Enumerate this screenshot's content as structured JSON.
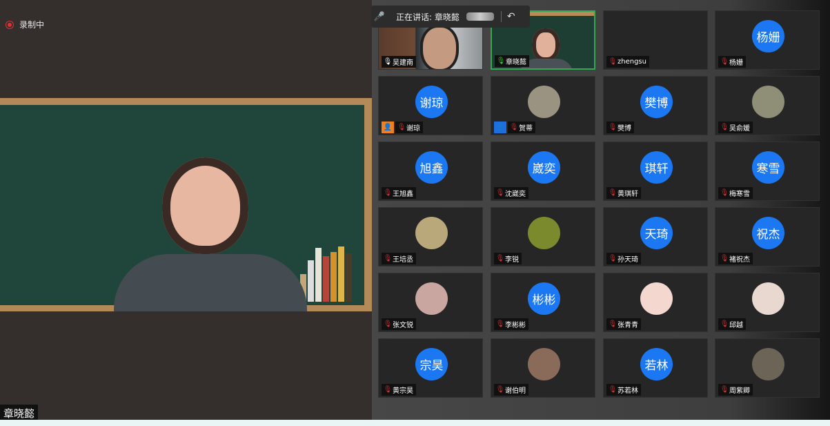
{
  "recording": {
    "label": "录制中",
    "icon": "record-icon"
  },
  "main_video": {
    "speaker_name": "章晓懿"
  },
  "speaking_bar": {
    "text": "正在讲话: 章晓懿",
    "mic_icon": "mic-muted-icon",
    "return_icon": "return-icon"
  },
  "participants": [
    {
      "name": "吴建南",
      "type": "video",
      "mic": "on",
      "row": 0,
      "col": 0
    },
    {
      "name": "章晓懿",
      "type": "video",
      "mic": "green",
      "row": 0,
      "col": 1,
      "active": true
    },
    {
      "name": "zhengsu",
      "type": "blank",
      "mic": "muted",
      "row": 0,
      "col": 2
    },
    {
      "name": "杨姗",
      "type": "avatar",
      "avatar_text": "杨姗",
      "mic": "muted",
      "row": 0,
      "col": 3
    },
    {
      "name": "谢琼",
      "type": "avatar",
      "avatar_text": "谢琼",
      "mic": "muted",
      "row": 1,
      "col": 0,
      "badge": "orange"
    },
    {
      "name": "贺蒂",
      "type": "photo",
      "photo_color": "#9a9382",
      "mic": "muted",
      "row": 1,
      "col": 1,
      "badge": "blue"
    },
    {
      "name": "樊博",
      "type": "avatar",
      "avatar_text": "樊博",
      "mic": "muted",
      "row": 1,
      "col": 2
    },
    {
      "name": "吴俞媛",
      "type": "photo",
      "photo_color": "#8f8f78",
      "mic": "muted",
      "row": 1,
      "col": 3
    },
    {
      "name": "王旭鑫",
      "type": "avatar",
      "avatar_text": "旭鑫",
      "mic": "muted",
      "row": 2,
      "col": 0
    },
    {
      "name": "沈崴奕",
      "type": "avatar",
      "avatar_text": "崴奕",
      "mic": "muted",
      "row": 2,
      "col": 1
    },
    {
      "name": "黄琪轩",
      "type": "avatar",
      "avatar_text": "琪轩",
      "mic": "muted",
      "row": 2,
      "col": 2
    },
    {
      "name": "梅寒雪",
      "type": "avatar",
      "avatar_text": "寒雪",
      "mic": "muted",
      "row": 2,
      "col": 3
    },
    {
      "name": "王培丞",
      "type": "photo",
      "photo_color": "#b9a87a",
      "mic": "muted",
      "row": 3,
      "col": 0
    },
    {
      "name": "李锐",
      "type": "photo",
      "photo_color": "#7b8a2c",
      "mic": "muted",
      "row": 3,
      "col": 1
    },
    {
      "name": "孙天琦",
      "type": "avatar",
      "avatar_text": "天琦",
      "mic": "muted",
      "row": 3,
      "col": 2
    },
    {
      "name": "褚祝杰",
      "type": "avatar",
      "avatar_text": "祝杰",
      "mic": "muted",
      "row": 3,
      "col": 3
    },
    {
      "name": "张文锐",
      "type": "photo",
      "photo_color": "#c9a7a0",
      "mic": "muted",
      "row": 4,
      "col": 0
    },
    {
      "name": "李彬彬",
      "type": "avatar",
      "avatar_text": "彬彬",
      "mic": "muted",
      "row": 4,
      "col": 1
    },
    {
      "name": "张青青",
      "type": "photo",
      "photo_color": "#f4d7cf",
      "mic": "muted",
      "row": 4,
      "col": 2
    },
    {
      "name": "邱越",
      "type": "photo",
      "photo_color": "#e8d8d0",
      "mic": "muted",
      "row": 4,
      "col": 3
    },
    {
      "name": "黄宗昊",
      "type": "avatar",
      "avatar_text": "宗昊",
      "mic": "muted",
      "row": 5,
      "col": 0
    },
    {
      "name": "谢伯明",
      "type": "photo",
      "photo_color": "#8a6b5a",
      "mic": "muted",
      "row": 5,
      "col": 1
    },
    {
      "name": "苏若林",
      "type": "avatar",
      "avatar_text": "若林",
      "mic": "muted",
      "row": 5,
      "col": 2
    },
    {
      "name": "周紫卿",
      "type": "photo",
      "photo_color": "#6b6457",
      "mic": "muted",
      "row": 5,
      "col": 3
    }
  ],
  "colors": {
    "avatar_blue": "#1b78f2",
    "active_border": "#34a853",
    "record_red": "#d33"
  }
}
